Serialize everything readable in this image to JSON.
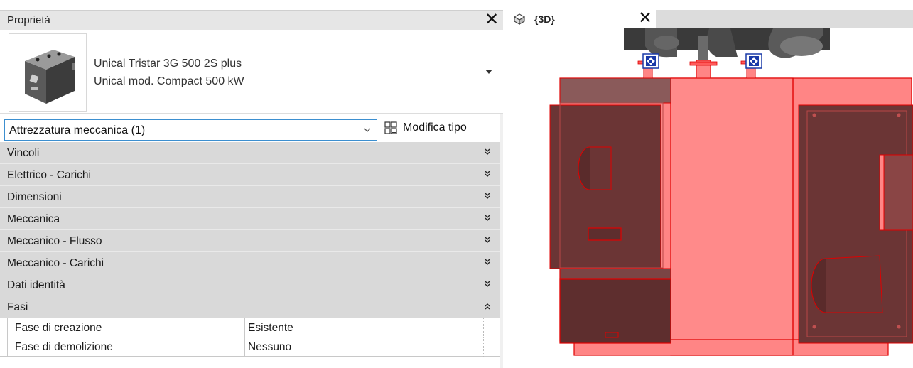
{
  "properties": {
    "title": "Proprietà",
    "close_glyph": "✕",
    "type_selector": {
      "family": "Unical Tristar 3G 500 2S plus",
      "type": "Unical mod. Compact 500 kW"
    },
    "instance_filter": "Attrezzatura meccanica (1)",
    "edit_type_label": "Modifica tipo",
    "groups": [
      {
        "label": "Vincoli",
        "expanded": false
      },
      {
        "label": "Elettrico - Carichi",
        "expanded": false
      },
      {
        "label": "Dimensioni",
        "expanded": false
      },
      {
        "label": "Meccanica",
        "expanded": false
      },
      {
        "label": "Meccanico - Flusso",
        "expanded": false
      },
      {
        "label": "Meccanico - Carichi",
        "expanded": false
      },
      {
        "label": "Dati identità",
        "expanded": false
      },
      {
        "label": "Fasi",
        "expanded": true
      }
    ],
    "phase_rows": [
      {
        "name": "Fase di creazione",
        "value": "Esistente"
      },
      {
        "name": "Fase di demolizione",
        "value": "Nessuno"
      }
    ]
  },
  "view": {
    "tab_label": "{3D}",
    "close_glyph": "✕"
  },
  "icons": {
    "close": "close-icon",
    "dropdown": "chevron-down-icon",
    "edit_type": "edit-type-icon",
    "collapsed": "double-chevron-down-icon",
    "expanded": "double-chevron-up-icon",
    "view3d": "3d-view-icon"
  },
  "colors": {
    "selection_fill": "#ff8585",
    "selection_edge": "#e00000",
    "dark_panel": "#6b3535",
    "group_header": "#d9d9d9",
    "focus_border": "#3c8fd0"
  }
}
